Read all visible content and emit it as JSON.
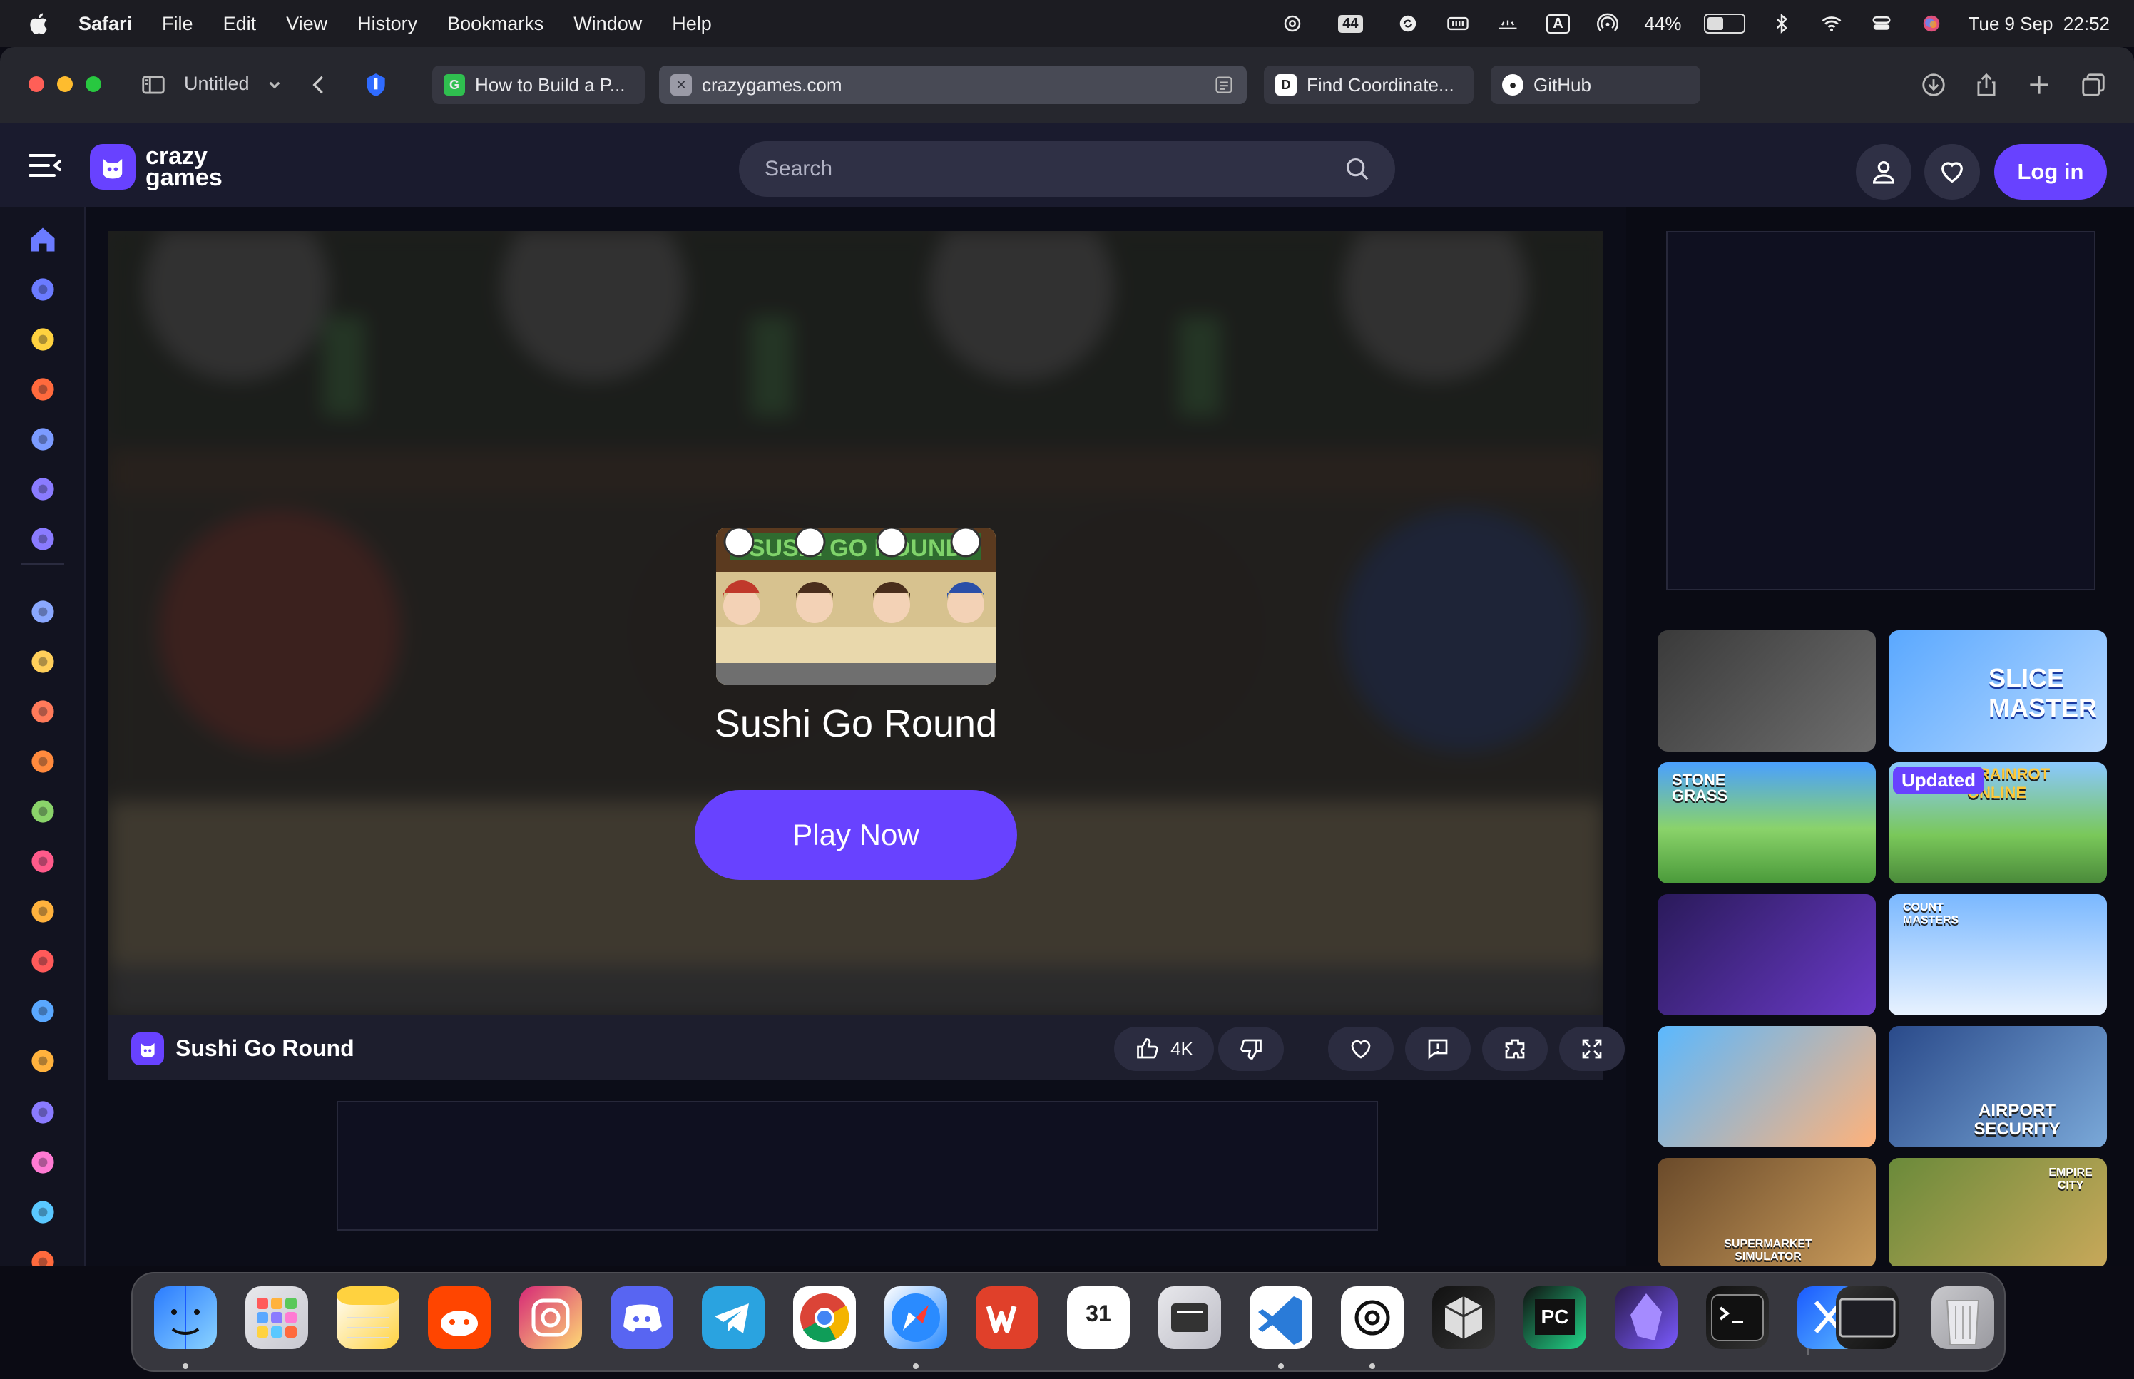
{
  "menubar": {
    "app_name": "Safari",
    "items": [
      "File",
      "Edit",
      "View",
      "History",
      "Bookmarks",
      "Window",
      "Help"
    ],
    "battery_percent": "44%",
    "battery_level": 0.44,
    "cpu_badge": "44",
    "input_source": "A",
    "datetime": "Tue 9 Sep  22:52",
    "icons": [
      "chatgpt-icon",
      "cpu-icon",
      "sync-icon",
      "memory-icon",
      "network-icon",
      "input-source-icon",
      "airdrop-icon",
      "battery-icon",
      "bluetooth-icon",
      "wifi-icon",
      "control-center-icon",
      "siri-icon"
    ]
  },
  "browser": {
    "window_title": "Untitled",
    "tabs": [
      {
        "label": "How to Build a P...",
        "favicon": "G",
        "favicon_color": "#2fbf4f"
      },
      {
        "label": "crazygames.com",
        "favicon": "✕",
        "favicon_color": "#9a9aa6",
        "active": true
      },
      {
        "label": "Find Coordinate...",
        "favicon": "D",
        "favicon_color": "#ffffff"
      },
      {
        "label": "GitHub",
        "favicon": "●",
        "favicon_color": "#ffffff"
      }
    ]
  },
  "site": {
    "logo_line1": "crazy",
    "logo_line2": "games",
    "search_placeholder": "Search",
    "login_label": "Log in",
    "accent_color": "#6842ff"
  },
  "sidebar": {
    "icons": [
      "home-icon",
      "recent-icon",
      "new-icon",
      "trending-icon",
      "updated-icon",
      "originals-icon",
      "multiplayer-icon",
      "two-player-icon",
      "action-icon",
      "adventure-icon",
      "basketball-icon",
      "casual-icon",
      "clicker-icon",
      "driving-icon",
      "card-icon",
      "controller-icon",
      "shooting-icon",
      "gamepad-icon",
      "dress-up-icon",
      "sports-icon",
      "exit-icon"
    ]
  },
  "game": {
    "title": "Sushi Go Round",
    "play_label": "Play Now",
    "bar_title": "Sushi Go Round",
    "likes": "4K"
  },
  "tiles": [
    {
      "title": "",
      "tag": ""
    },
    {
      "title": "SLICE MASTER",
      "tag": ""
    },
    {
      "title": "STONE GRASS",
      "tag": ""
    },
    {
      "title": "BRAINROT ONLINE",
      "tag": "Updated"
    },
    {
      "title": "",
      "tag": ""
    },
    {
      "title": "COUNT MASTERS",
      "tag": ""
    },
    {
      "title": "",
      "tag": ""
    },
    {
      "title": "AIRPORT SECURITY",
      "tag": ""
    },
    {
      "title": "SUPERMARKET SIMULATOR",
      "tag": ""
    },
    {
      "title": "EMPIRE CITY",
      "tag": ""
    }
  ],
  "dock": {
    "apps": [
      "finder",
      "launchpad",
      "notes",
      "reddit",
      "instagram",
      "discord",
      "telegram",
      "chrome",
      "safari",
      "wps",
      "calendar",
      "reminders-app",
      "vscode",
      "chatgpt",
      "cube-app",
      "pycharm",
      "obsidian",
      "terminal",
      "xcode",
      "screen-app",
      "trash"
    ],
    "calendar_day": "31",
    "pycharm_label": "PC"
  }
}
